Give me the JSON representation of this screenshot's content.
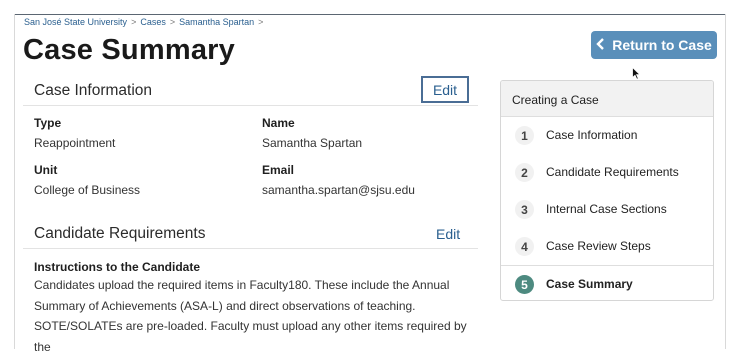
{
  "breadcrumb": {
    "items": [
      "San José State University",
      "Cases",
      "Samantha Spartan"
    ],
    "separator": ">"
  },
  "page": {
    "title": "Case Summary"
  },
  "header": {
    "return_label": "Return to Case",
    "return_icon": "chevron-left-icon"
  },
  "case_information": {
    "title": "Case Information",
    "edit_label": "Edit",
    "fields": {
      "type": {
        "label": "Type",
        "value": "Reappointment"
      },
      "name": {
        "label": "Name",
        "value": "Samantha Spartan"
      },
      "unit": {
        "label": "Unit",
        "value": "College of Business"
      },
      "email": {
        "label": "Email",
        "value": "samantha.spartan@sjsu.edu"
      }
    }
  },
  "candidate_requirements": {
    "title": "Candidate Requirements",
    "edit_label": "Edit",
    "instructions_label": "Instructions to the Candidate",
    "instructions_text": "Candidates upload the required items in Faculty180. These include the Annual Summary of Achievements (ASA-L) and direct observations of teaching. SOTE/SOLATEs are pre-loaded. Faculty must upload any other items required by the"
  },
  "steps_panel": {
    "title": "Creating a Case",
    "steps": [
      {
        "num": "1",
        "label": "Case Information"
      },
      {
        "num": "2",
        "label": "Candidate Requirements"
      },
      {
        "num": "3",
        "label": "Internal Case Sections"
      },
      {
        "num": "4",
        "label": "Case Review Steps"
      },
      {
        "num": "5",
        "label": "Case Summary"
      }
    ],
    "active_step": "5"
  },
  "colors": {
    "accent_button": "#5a8fba",
    "link": "#2a5f8f",
    "active_step": "#4d8a80"
  }
}
